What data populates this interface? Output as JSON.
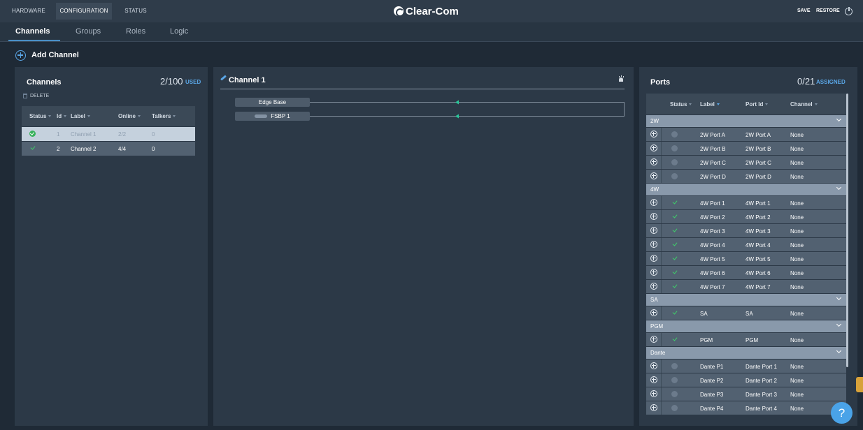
{
  "topbar": {
    "tabs": [
      {
        "label": "HARDWARE",
        "active": false
      },
      {
        "label": "CONFIGURATION",
        "active": true
      },
      {
        "label": "STATUS",
        "active": false
      }
    ],
    "brand": "Clear-Com",
    "save_label": "SAVE",
    "restore_label": "RESTORE"
  },
  "subnav": {
    "tabs": [
      {
        "label": "Channels",
        "active": true
      },
      {
        "label": "Groups",
        "active": false
      },
      {
        "label": "Roles",
        "active": false
      },
      {
        "label": "Logic",
        "active": false
      }
    ]
  },
  "add_channel_label": "Add Channel",
  "channels_panel": {
    "title": "Channels",
    "count": "2/100",
    "count_suffix": "USED",
    "delete_label": "DELETE",
    "columns": [
      "Status",
      "Id",
      "Label",
      "Online",
      "Talkers"
    ],
    "rows": [
      {
        "id": "1",
        "label": "Channel 1",
        "online": "2/2",
        "talkers": "0",
        "selected": true
      },
      {
        "id": "2",
        "label": "Channel 2",
        "online": "4/4",
        "talkers": "0",
        "selected": false
      }
    ]
  },
  "detail_panel": {
    "title": "Channel 1",
    "nodes": [
      "Edge Base",
      "FSBP 1"
    ]
  },
  "ports_panel": {
    "title": "Ports",
    "count": "0/21",
    "count_suffix": "ASSIGNED",
    "columns": [
      "Status",
      "Label",
      "Port Id",
      "Channel"
    ],
    "groups": [
      {
        "name": "2W",
        "ports": [
          {
            "label": "2W Port A",
            "port_id": "2W Port A",
            "channel": "None",
            "active": false
          },
          {
            "label": "2W Port B",
            "port_id": "2W Port B",
            "channel": "None",
            "active": false
          },
          {
            "label": "2W Port C",
            "port_id": "2W Port C",
            "channel": "None",
            "active": false
          },
          {
            "label": "2W Port D",
            "port_id": "2W Port D",
            "channel": "None",
            "active": false
          }
        ]
      },
      {
        "name": "4W",
        "ports": [
          {
            "label": "4W Port 1",
            "port_id": "4W Port 1",
            "channel": "None",
            "active": true
          },
          {
            "label": "4W Port 2",
            "port_id": "4W Port 2",
            "channel": "None",
            "active": true
          },
          {
            "label": "4W Port 3",
            "port_id": "4W Port 3",
            "channel": "None",
            "active": true
          },
          {
            "label": "4W Port 4",
            "port_id": "4W Port 4",
            "channel": "None",
            "active": true
          },
          {
            "label": "4W Port 5",
            "port_id": "4W Port 5",
            "channel": "None",
            "active": true
          },
          {
            "label": "4W Port 6",
            "port_id": "4W Port 6",
            "channel": "None",
            "active": true
          },
          {
            "label": "4W Port 7",
            "port_id": "4W Port 7",
            "channel": "None",
            "active": true
          }
        ]
      },
      {
        "name": "SA",
        "ports": [
          {
            "label": "SA",
            "port_id": "SA",
            "channel": "None",
            "active": true
          }
        ]
      },
      {
        "name": "PGM",
        "ports": [
          {
            "label": "PGM",
            "port_id": "PGM",
            "channel": "None",
            "active": true
          }
        ]
      },
      {
        "name": "Dante",
        "ports": [
          {
            "label": "Dante P1",
            "port_id": "Dante Port 1",
            "channel": "None",
            "active": false
          },
          {
            "label": "Dante P2",
            "port_id": "Dante Port 2",
            "channel": "None",
            "active": false
          },
          {
            "label": "Dante P3",
            "port_id": "Dante Port 3",
            "channel": "None",
            "active": false
          },
          {
            "label": "Dante P4",
            "port_id": "Dante Port 4",
            "channel": "None",
            "active": false
          }
        ]
      }
    ]
  },
  "help_label": "?",
  "colors": {
    "accent": "#4aa3e8",
    "status_green": "#37b15a",
    "connection_line": "#2bc79a"
  }
}
